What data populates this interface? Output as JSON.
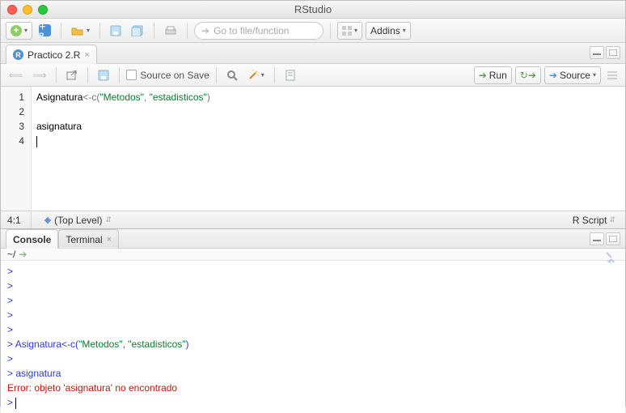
{
  "window": {
    "title": "RStudio"
  },
  "maintoolbar": {
    "goto_placeholder": "Go to file/function",
    "addins_label": "Addins"
  },
  "source": {
    "tab_label": "Practico 2.R",
    "save_on_source_label": "Source on Save",
    "run_label": "Run",
    "source_btn_label": "Source",
    "status_pos": "4:1",
    "scope_label": "(Top Level)",
    "lang_label": "R Script",
    "lines": [
      "1",
      "2",
      "3",
      "4"
    ],
    "line1_fn": "Asignatura",
    "line1_op": "<-c(",
    "line1_s1": "\"Metodos\"",
    "line1_sep": ", ",
    "line1_s2": "\"estadisticos\"",
    "line1_cl": ")",
    "line3": "asignatura"
  },
  "console": {
    "tab_console": "Console",
    "tab_terminal": "Terminal",
    "path_label": "~/",
    "cmd1_a": "Asignatura<-c(",
    "cmd1_s1": "\"Metodos\"",
    "cmd1_sep": ", ",
    "cmd1_s2": "\"estadisticos\"",
    "cmd1_b": ")",
    "cmd2": "asignatura",
    "error": "Error: objeto 'asignatura' no encontrado"
  }
}
